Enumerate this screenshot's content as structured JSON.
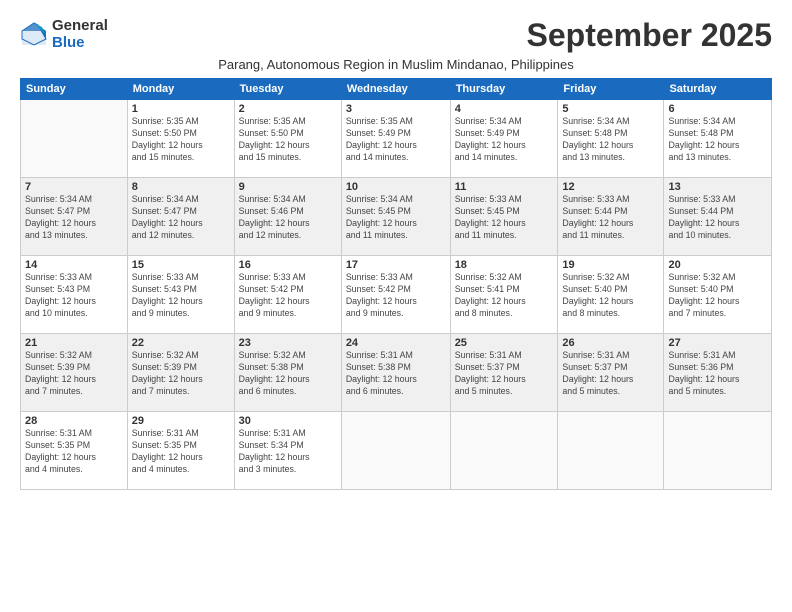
{
  "logo": {
    "general": "General",
    "blue": "Blue"
  },
  "title": "September 2025",
  "subtitle": "Parang, Autonomous Region in Muslim Mindanao, Philippines",
  "days_of_week": [
    "Sunday",
    "Monday",
    "Tuesday",
    "Wednesday",
    "Thursday",
    "Friday",
    "Saturday"
  ],
  "weeks": [
    [
      {
        "num": "",
        "detail": ""
      },
      {
        "num": "1",
        "detail": "Sunrise: 5:35 AM\nSunset: 5:50 PM\nDaylight: 12 hours\nand 15 minutes."
      },
      {
        "num": "2",
        "detail": "Sunrise: 5:35 AM\nSunset: 5:50 PM\nDaylight: 12 hours\nand 15 minutes."
      },
      {
        "num": "3",
        "detail": "Sunrise: 5:35 AM\nSunset: 5:49 PM\nDaylight: 12 hours\nand 14 minutes."
      },
      {
        "num": "4",
        "detail": "Sunrise: 5:34 AM\nSunset: 5:49 PM\nDaylight: 12 hours\nand 14 minutes."
      },
      {
        "num": "5",
        "detail": "Sunrise: 5:34 AM\nSunset: 5:48 PM\nDaylight: 12 hours\nand 13 minutes."
      },
      {
        "num": "6",
        "detail": "Sunrise: 5:34 AM\nSunset: 5:48 PM\nDaylight: 12 hours\nand 13 minutes."
      }
    ],
    [
      {
        "num": "7",
        "detail": "Sunrise: 5:34 AM\nSunset: 5:47 PM\nDaylight: 12 hours\nand 13 minutes."
      },
      {
        "num": "8",
        "detail": "Sunrise: 5:34 AM\nSunset: 5:47 PM\nDaylight: 12 hours\nand 12 minutes."
      },
      {
        "num": "9",
        "detail": "Sunrise: 5:34 AM\nSunset: 5:46 PM\nDaylight: 12 hours\nand 12 minutes."
      },
      {
        "num": "10",
        "detail": "Sunrise: 5:34 AM\nSunset: 5:45 PM\nDaylight: 12 hours\nand 11 minutes."
      },
      {
        "num": "11",
        "detail": "Sunrise: 5:33 AM\nSunset: 5:45 PM\nDaylight: 12 hours\nand 11 minutes."
      },
      {
        "num": "12",
        "detail": "Sunrise: 5:33 AM\nSunset: 5:44 PM\nDaylight: 12 hours\nand 11 minutes."
      },
      {
        "num": "13",
        "detail": "Sunrise: 5:33 AM\nSunset: 5:44 PM\nDaylight: 12 hours\nand 10 minutes."
      }
    ],
    [
      {
        "num": "14",
        "detail": "Sunrise: 5:33 AM\nSunset: 5:43 PM\nDaylight: 12 hours\nand 10 minutes."
      },
      {
        "num": "15",
        "detail": "Sunrise: 5:33 AM\nSunset: 5:43 PM\nDaylight: 12 hours\nand 9 minutes."
      },
      {
        "num": "16",
        "detail": "Sunrise: 5:33 AM\nSunset: 5:42 PM\nDaylight: 12 hours\nand 9 minutes."
      },
      {
        "num": "17",
        "detail": "Sunrise: 5:33 AM\nSunset: 5:42 PM\nDaylight: 12 hours\nand 9 minutes."
      },
      {
        "num": "18",
        "detail": "Sunrise: 5:32 AM\nSunset: 5:41 PM\nDaylight: 12 hours\nand 8 minutes."
      },
      {
        "num": "19",
        "detail": "Sunrise: 5:32 AM\nSunset: 5:40 PM\nDaylight: 12 hours\nand 8 minutes."
      },
      {
        "num": "20",
        "detail": "Sunrise: 5:32 AM\nSunset: 5:40 PM\nDaylight: 12 hours\nand 7 minutes."
      }
    ],
    [
      {
        "num": "21",
        "detail": "Sunrise: 5:32 AM\nSunset: 5:39 PM\nDaylight: 12 hours\nand 7 minutes."
      },
      {
        "num": "22",
        "detail": "Sunrise: 5:32 AM\nSunset: 5:39 PM\nDaylight: 12 hours\nand 7 minutes."
      },
      {
        "num": "23",
        "detail": "Sunrise: 5:32 AM\nSunset: 5:38 PM\nDaylight: 12 hours\nand 6 minutes."
      },
      {
        "num": "24",
        "detail": "Sunrise: 5:31 AM\nSunset: 5:38 PM\nDaylight: 12 hours\nand 6 minutes."
      },
      {
        "num": "25",
        "detail": "Sunrise: 5:31 AM\nSunset: 5:37 PM\nDaylight: 12 hours\nand 5 minutes."
      },
      {
        "num": "26",
        "detail": "Sunrise: 5:31 AM\nSunset: 5:37 PM\nDaylight: 12 hours\nand 5 minutes."
      },
      {
        "num": "27",
        "detail": "Sunrise: 5:31 AM\nSunset: 5:36 PM\nDaylight: 12 hours\nand 5 minutes."
      }
    ],
    [
      {
        "num": "28",
        "detail": "Sunrise: 5:31 AM\nSunset: 5:35 PM\nDaylight: 12 hours\nand 4 minutes."
      },
      {
        "num": "29",
        "detail": "Sunrise: 5:31 AM\nSunset: 5:35 PM\nDaylight: 12 hours\nand 4 minutes."
      },
      {
        "num": "30",
        "detail": "Sunrise: 5:31 AM\nSunset: 5:34 PM\nDaylight: 12 hours\nand 3 minutes."
      },
      {
        "num": "",
        "detail": ""
      },
      {
        "num": "",
        "detail": ""
      },
      {
        "num": "",
        "detail": ""
      },
      {
        "num": "",
        "detail": ""
      }
    ]
  ]
}
